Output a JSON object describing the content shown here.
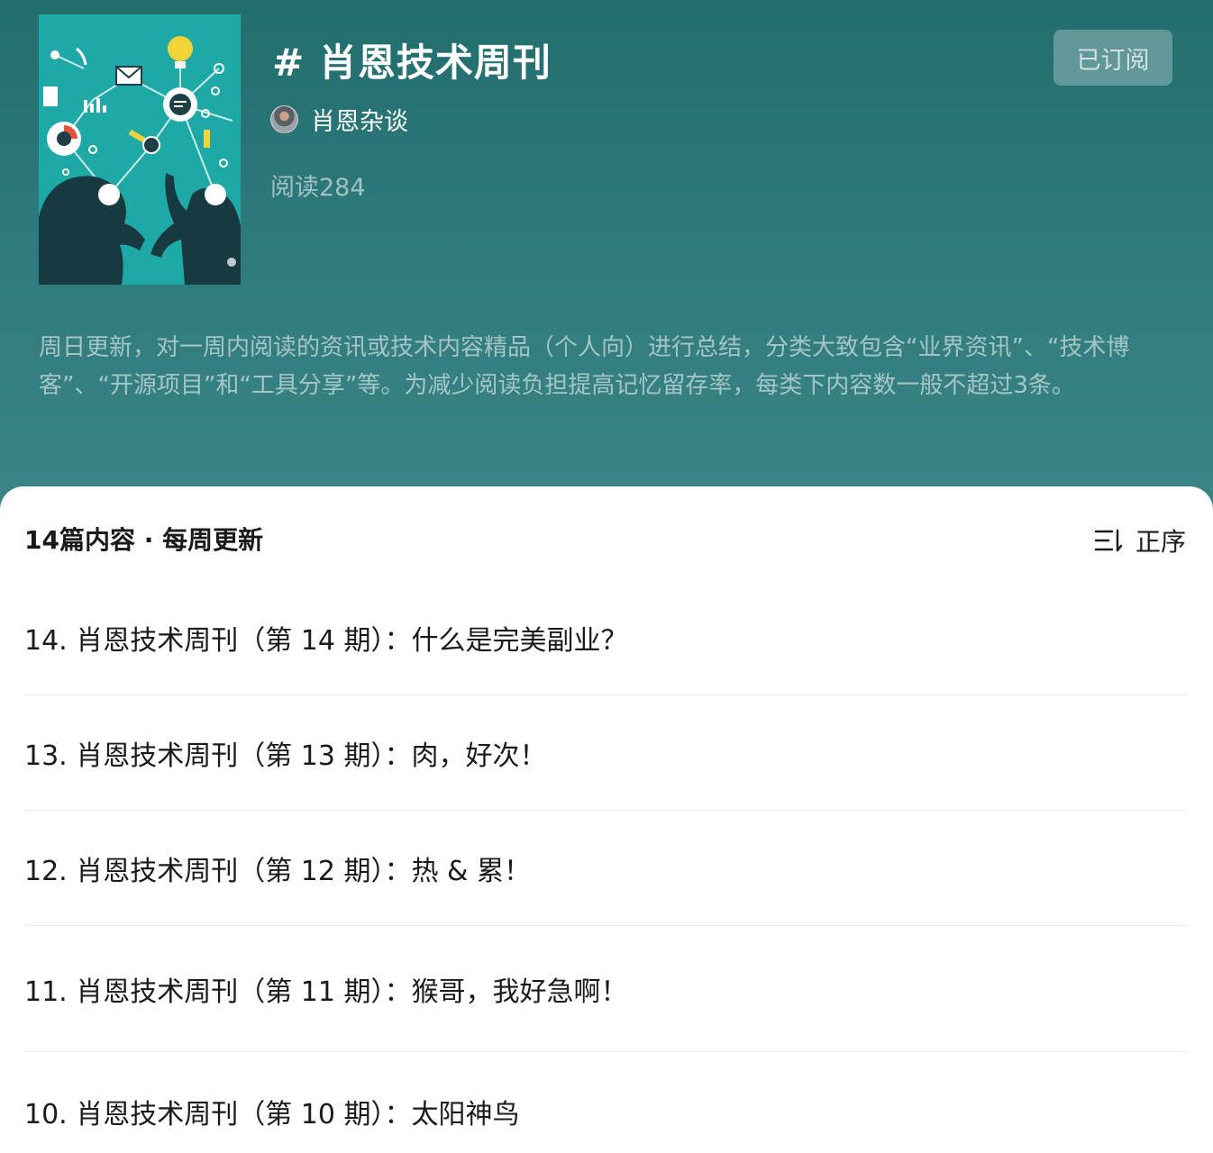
{
  "album": {
    "title": "# 肖恩技术周刊",
    "author": "肖恩杂谈",
    "read_count": "阅读284",
    "subscribe_label": "已订阅",
    "description": "周日更新，对一周内阅读的资讯或技术内容精品（个人向）进行总结，分类大致包含“业界资讯”、“技术博客”、“开源项目”和“工具分享”等。为减少阅读负担提高记忆留存率，每类下内容数一般不超过3条。"
  },
  "list": {
    "summary": "14篇内容 · 每周更新",
    "sort_label": "正序",
    "articles": [
      {
        "title": "14. 肖恩技术周刊（第 14 期）：什么是完美副业？"
      },
      {
        "title": "13. 肖恩技术周刊（第 13 期）：肉，好次！"
      },
      {
        "title": "12. 肖恩技术周刊（第 12 期）：热 & 累！"
      },
      {
        "title": "11. 肖恩技术周刊（第 11 期）：猴哥，我好急啊！"
      },
      {
        "title": "10. 肖恩技术周刊（第 10 期）：太阳神鸟"
      }
    ]
  },
  "colors": {
    "header_bg": "#2f7a7c",
    "cover_bg": "#1fa9a6",
    "text_primary": "#1a1a1a",
    "divider": "#ececec"
  },
  "icons": {
    "cover": "cover-illustration",
    "avatar": "author-avatar",
    "sort": "sort-icon"
  }
}
